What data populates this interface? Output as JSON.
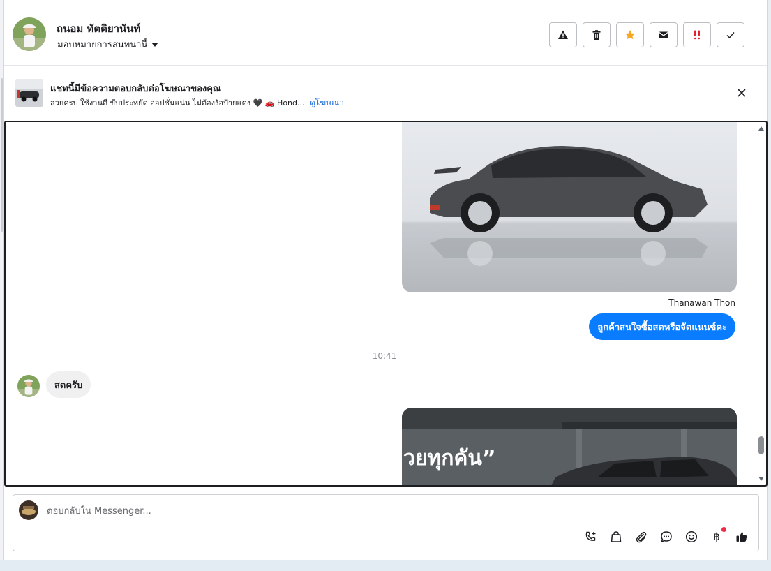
{
  "header": {
    "contact_name": "ถนอม ทัตติยานันท์",
    "assign_label": "มอบหมายการสนทนานี้",
    "actions": [
      {
        "name": "spam",
        "icon": "warning-icon"
      },
      {
        "name": "delete",
        "icon": "trash-icon"
      },
      {
        "name": "star",
        "icon": "star-icon"
      },
      {
        "name": "mark-unread",
        "icon": "envelope-icon"
      },
      {
        "name": "follow-up",
        "icon": "double-exclamation-icon"
      },
      {
        "name": "done",
        "icon": "check-icon"
      }
    ],
    "colors": {
      "star": "#f5a623",
      "follow_up": "#e4222f"
    }
  },
  "ad_banner": {
    "title": "แชทนี้มีข้อความตอบกลับต่อโฆษณาของคุณ",
    "subtitle": "สวยครบ ใช้งานดี ขับประหยัด ออปชั่นแน่น ไม่ต้องง้อป้ายแดง 🖤 🚗 Hond...",
    "link_label": "ดูโฆษณา",
    "close_icon": "close-icon"
  },
  "conversation": {
    "sender_name": "Thanawan Thon",
    "outgoing_message": "ลูกค้าสนใจซื้อสดหรือจัดแนนซ์คะ",
    "timestamp": "10:41",
    "incoming_message": "สดครับ",
    "image_overlay_text": "วยทุกคัน”",
    "colors": {
      "outgoing_bubble": "#0a7cff",
      "incoming_bubble": "#f0f0f0"
    }
  },
  "composer": {
    "placeholder": "ตอบกลับใน Messenger...",
    "tools": [
      "phone-plus-icon",
      "shopping-bag-icon",
      "paperclip-icon",
      "chat-bubble-icon",
      "emoji-icon",
      "baht-icon",
      "thumbs-up-icon"
    ],
    "baht_symbol": "฿"
  }
}
